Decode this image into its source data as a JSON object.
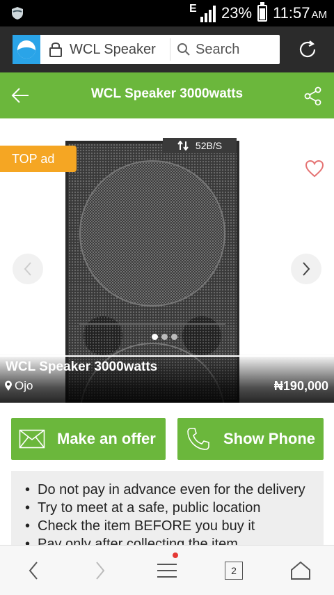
{
  "status_bar": {
    "network": "E",
    "battery_percent": "23%",
    "time": "11:57",
    "ampm": "AM",
    "icons": [
      "shield-icon",
      "signal-icon",
      "battery-icon"
    ]
  },
  "browser": {
    "url_text": "WCL Speaker",
    "search_label": "Search",
    "icons": [
      "browser-logo-icon",
      "lock-icon",
      "search-icon",
      "refresh-icon"
    ]
  },
  "header": {
    "title": "WCL Speaker 3000watts",
    "icons": [
      "back-arrow-icon",
      "share-icon"
    ],
    "background_color": "#6bb73c"
  },
  "gallery": {
    "net_speed": "52B/S",
    "badge": "TOP ad",
    "badge_color": "#f5a623",
    "image_count": 3,
    "active_image": 1,
    "icons": [
      "heart-icon",
      "chevron-left-icon",
      "chevron-right-icon",
      "transfer-icon"
    ]
  },
  "listing": {
    "title": "WCL Speaker 3000watts",
    "location": "Ojo",
    "price": "₦190,000"
  },
  "actions": {
    "offer_label": "Make an offer",
    "phone_label": "Show Phone",
    "icons": [
      "envelope-icon",
      "phone-icon"
    ]
  },
  "tips": {
    "items": [
      "Do not pay in advance even for the delivery",
      "Try to meet at a safe, public location",
      "Check the item BEFORE you buy it",
      "Pay only after collecting the item"
    ]
  },
  "bottom_nav": {
    "tab_count": "2",
    "icons": [
      "back-icon",
      "forward-icon",
      "menu-icon",
      "tabs-icon",
      "home-icon"
    ]
  }
}
